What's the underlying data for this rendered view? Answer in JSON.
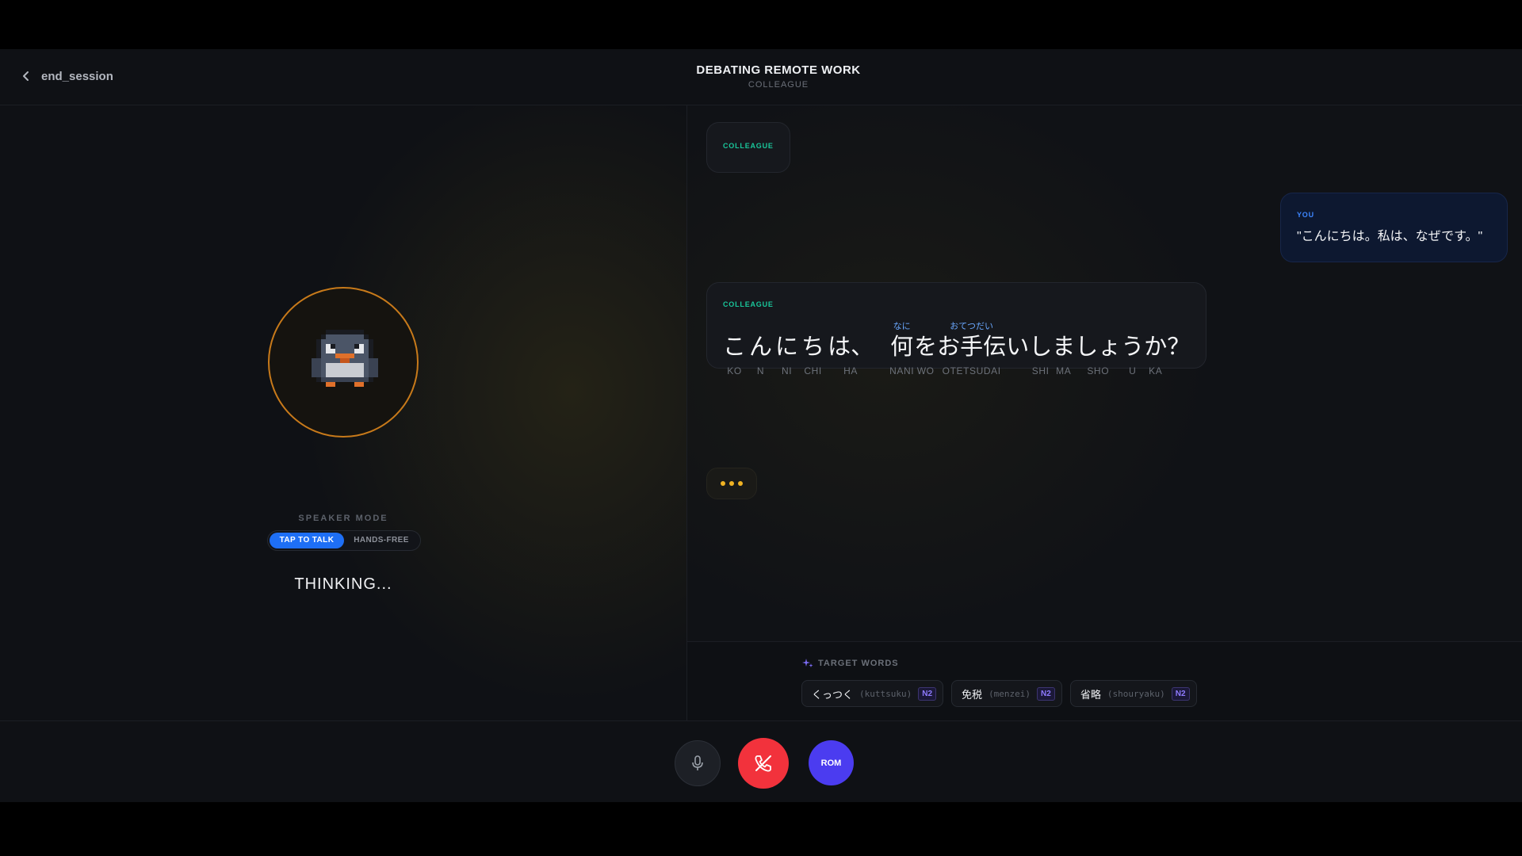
{
  "header": {
    "back_label": "end_session",
    "title": "DEBATING REMOTE WORK",
    "subtitle": "COLLEAGUE"
  },
  "left": {
    "speaker_mode_label": "SPEAKER MODE",
    "mode_options": [
      "TAP TO TALK",
      "HANDS-FREE"
    ],
    "active_mode": "TAP TO TALK",
    "status": "THINKING...",
    "avatar_ring_color": "#c87a1a"
  },
  "messages": [
    {
      "role": "COLLEAGUE",
      "text": ""
    },
    {
      "role": "YOU",
      "text": "\"こんにちは。私は、なぜです。\""
    },
    {
      "role": "COLLEAGUE",
      "tokens": [
        {
          "surface": "こ",
          "romaji": "KO",
          "ruby": ""
        },
        {
          "surface": "ん",
          "romaji": "N",
          "ruby": ""
        },
        {
          "surface": "に",
          "romaji": "NI",
          "ruby": ""
        },
        {
          "surface": "ち",
          "romaji": "CHI",
          "ruby": ""
        },
        {
          "surface": "は、",
          "romaji": "HA",
          "ruby": ""
        },
        {
          "surface": "何",
          "romaji": "NANI",
          "ruby": "なに"
        },
        {
          "surface": "を",
          "romaji": "WO",
          "ruby": ""
        },
        {
          "surface": "お手伝",
          "romaji": "OTETSUDAI",
          "ruby": "おてつだい"
        },
        {
          "surface": "い",
          "romaji": "",
          "ruby": ""
        },
        {
          "surface": "し",
          "romaji": "SHI",
          "ruby": ""
        },
        {
          "surface": "ま",
          "romaji": "MA",
          "ruby": ""
        },
        {
          "surface": "しょ",
          "romaji": "SHO",
          "ruby": ""
        },
        {
          "surface": "う",
          "romaji": "U",
          "ruby": ""
        },
        {
          "surface": "か",
          "romaji": "KA",
          "ruby": ""
        },
        {
          "surface": "？",
          "romaji": "",
          "ruby": ""
        }
      ]
    }
  ],
  "target_words": {
    "label": "TARGET WORDS",
    "items": [
      {
        "word": "くっつく",
        "reading": "(kuttsuku)",
        "level": "N2"
      },
      {
        "word": "免税",
        "reading": "(menzei)",
        "level": "N2"
      },
      {
        "word": "省略",
        "reading": "(shouryaku)",
        "level": "N2"
      }
    ]
  },
  "controls": {
    "mic_icon": "microphone-icon",
    "hangup_icon": "phone-off-icon",
    "romaji_label": "ROM"
  },
  "colors": {
    "accent_blue": "#1e6ff5",
    "colleague_green": "#19c69a",
    "you_blue": "#3d86ff",
    "hangup_red": "#f2323c",
    "romaji_purple": "#4b3cf0",
    "typing_yellow": "#f0b323"
  }
}
